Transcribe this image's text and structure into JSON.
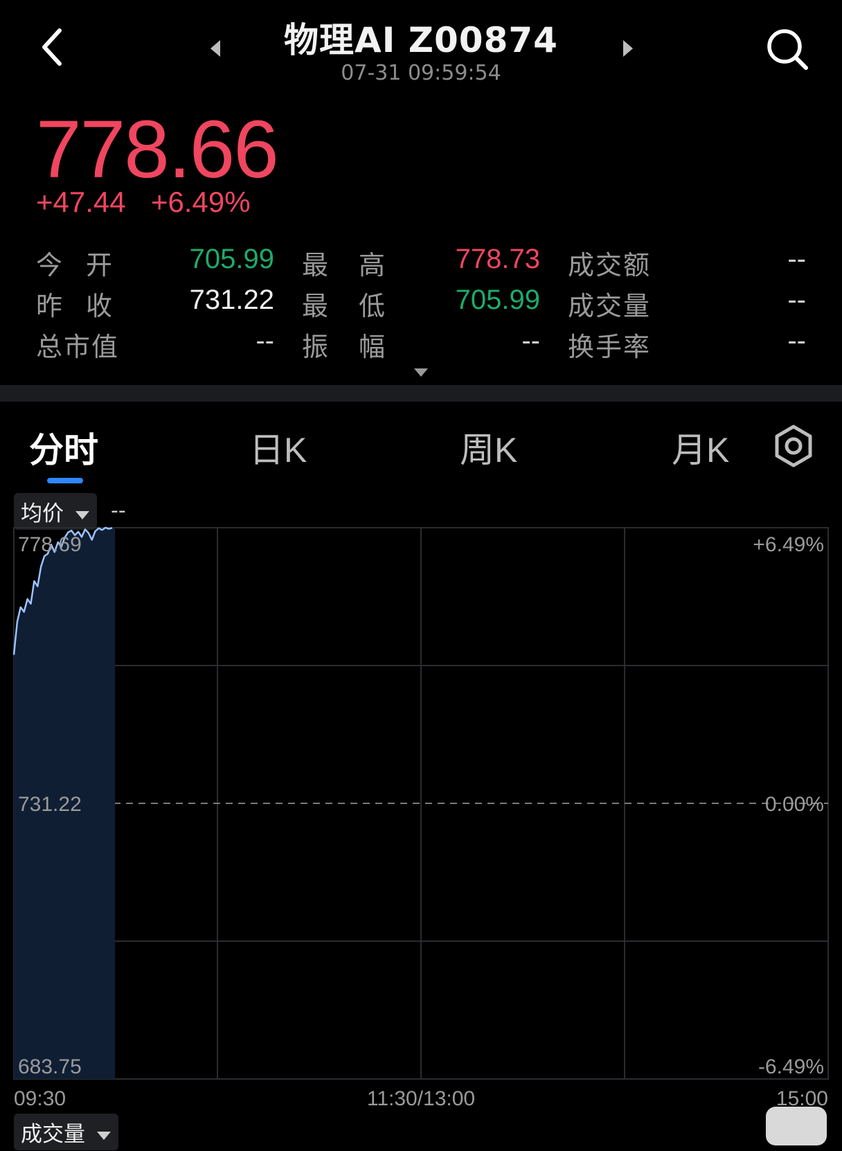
{
  "header": {
    "title": "物理AI Z00874",
    "timestamp": "07-31 09:59:54"
  },
  "quote": {
    "price": "778.66",
    "change": "+47.44",
    "change_pct": "+6.49%",
    "stats": {
      "open_label": "今开",
      "open_value": "705.99",
      "high_label": "最高",
      "high_value": "778.73",
      "turnover_label": "成交额",
      "turnover_value": "--",
      "prev_close_label": "昨收",
      "prev_close_value": "731.22",
      "low_label": "最低",
      "low_value": "705.99",
      "volume_label": "成交量",
      "volume_value": "--",
      "market_cap_label": "总市值",
      "market_cap_value": "--",
      "amplitude_label": "振幅",
      "amplitude_value": "--",
      "turnover_rate_label": "换手率",
      "turnover_rate_value": "--"
    }
  },
  "tabs": [
    {
      "label": "分时",
      "active": true
    },
    {
      "label": "日K",
      "active": false
    },
    {
      "label": "周K",
      "active": false
    },
    {
      "label": "月K",
      "active": false
    }
  ],
  "chart_controls": {
    "avg_price_label": "均价",
    "avg_price_value": "--",
    "volume_label": "成交量"
  },
  "chart_data": {
    "type": "line",
    "y_left_labels": [
      "778.69",
      "731.22",
      "683.75"
    ],
    "y_right_labels": [
      "+6.49%",
      "0.00%",
      "-6.49%"
    ],
    "x_labels": [
      "09:30",
      "11:30/13:00",
      "15:00"
    ],
    "ylim": [
      683.75,
      778.69
    ],
    "baseline": 731.22,
    "series": [
      {
        "x": [
          "09:30",
          "09:31",
          "09:32",
          "09:33",
          "09:34",
          "09:35",
          "09:36",
          "09:37",
          "09:38",
          "09:39",
          "09:40",
          "09:41",
          "09:42",
          "09:43",
          "09:44",
          "09:45",
          "09:46",
          "09:47",
          "09:48",
          "09:49",
          "09:50",
          "09:51",
          "09:52",
          "09:53",
          "09:54",
          "09:55",
          "09:56",
          "09:57",
          "09:58",
          "09:59"
        ],
        "values": [
          756.8,
          762.5,
          765.0,
          764.2,
          766.4,
          765.6,
          769.5,
          768.6,
          772.0,
          773.8,
          774.2,
          775.8,
          774.5,
          776.2,
          775.4,
          777.0,
          777.9,
          778.2,
          777.4,
          778.0,
          777.1,
          778.4,
          777.8,
          776.6,
          778.1,
          778.6,
          778.3,
          778.7,
          778.5,
          778.66
        ]
      }
    ],
    "colors": {
      "line": "#9cc3ff",
      "fill": "#0f1e33",
      "grid": "#2a2c30",
      "price_up": "#f0465f",
      "price_down": "#1dac6a",
      "tab_indicator": "#2f87ff"
    }
  }
}
